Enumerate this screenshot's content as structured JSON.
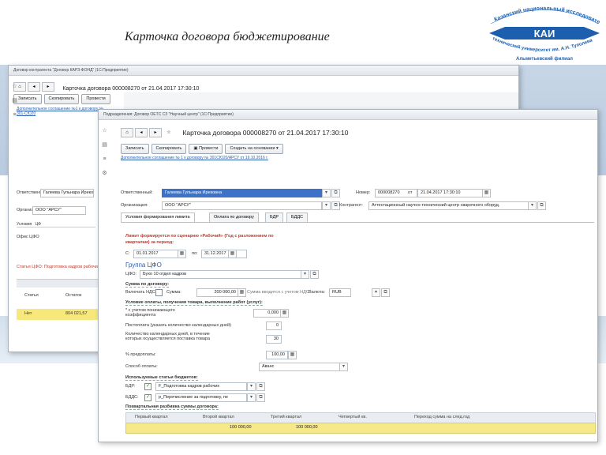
{
  "slide": {
    "title": "Карточка договора бюджетирование",
    "logo_text_top": "Казанский национальный исследовательский",
    "logo_text_mid": "технический университет им. А.Н. Туполева",
    "logo_text_bottom": "Альметьевский филиал",
    "logo_mark": "КАИ",
    "brand_color": "#1b5fae"
  },
  "back_window": {
    "titlebar": "Договор контрагента \"Договор КАРЗ-ФОНД\" (1С:Предприятие)",
    "title": "Карточка договора 000008270 от 21.04.2017 17:30:10",
    "buttons": [
      "Записать",
      "Скопировать",
      "Провести"
    ],
    "link": "Дополнительное соглашение №1 к договору № 301-СЮ20",
    "responsible_label": "Ответственный",
    "responsible_value": "Галеева Гульнара Ирековна",
    "org_label": "Организация",
    "org_value": "ООО \"АРСУ\"",
    "tab_label": "Условия",
    "tab_label2": "ЦФ",
    "group_label": "Офис ЦФО",
    "rows": [
      {
        "a": "Статья",
        "b": "Остаток"
      },
      {
        "a": "Нет",
        "b": "804 021,57"
      },
      {
        "a": "Нет",
        "b": "804 021,57"
      }
    ],
    "note": "Статья ЦФО: Подготовка кадров рабочих"
  },
  "front_window": {
    "titlebar": "Подразделения: Договор ОЕТС СЗ \"Научный центр\" (1С:Предприятие)",
    "title": "Карточка договора 000008270 от 21.04.2017 17:30:10",
    "nav_icons": [
      "home-icon",
      "back-icon",
      "forward-icon",
      "star-icon"
    ],
    "buttons": [
      "Записать",
      "Скопировать",
      "Провести",
      "Создать на основании"
    ],
    "link": "Дополнительное соглашение № 1 к договору № 301СЮ20/АРСУ от 19.10.2016 г.",
    "responsible_label": "Ответственный:",
    "responsible_value": "Галеева Гульнара Ирековна",
    "number_label": "Номер:",
    "number_value": "000008270",
    "date_label": "от",
    "date_value": "21.04.2017 17:30:10",
    "org_label": "Организация:",
    "org_value": "ООО \"АРСУ\"",
    "counterparty_label": "Контрагент:",
    "counterparty_value": "Аттестационный научно-технический центр сварочного оборуд.",
    "tabs": [
      "Условия формирования лимита",
      "Оплата по договору",
      "БДР",
      "БДДС"
    ],
    "limit_note_line1": "Лимит формируется по сценарию «Рабочий» (Год с разложением по",
    "limit_note_line2": "кварталам) за период:",
    "period_from_label": "С:",
    "period_from": "01.01.2017",
    "period_to_label": "по:",
    "period_to": "31.12.2017",
    "group_title": "Группа ЦФО",
    "cfo_label": "ЦФО:",
    "cfo_value": "Бухо 10 отдел кадров",
    "sum_section": "Сумма по договору:",
    "vat_label": "Включать НДС",
    "sum_label": "Сумма:",
    "sum_value": "200 000,00",
    "sum_vat_note": "Сумма вводится с учетом НДС",
    "currency_label": "Валюта:",
    "currency_value": "RUB",
    "payment_section": "Условие оплаты, получения товара, выполнение работ (услуг):",
    "advance_coef_label": "* с учетом понижающего коэффициента",
    "advance_coef_value": "0,000",
    "postpay_label": "Постоплата (указать количество календарных дней)",
    "postpay_value": "0",
    "days_label": "Количество календарных дней, в течение которых осуществляется поставка товара",
    "days_value": "30",
    "prepay_label": "% предоплаты:",
    "prepay_value": "100,00",
    "pay_method_label": "Способ оплаты:",
    "pay_method_value": "Аванс",
    "items_section": "Используемые статьи бюджетов:",
    "bdr_label": "БДР:",
    "bdr_value": "F_Подготовка кадров рабочих",
    "bdds_label": "БДДС:",
    "bdds_value": "р_Перечисление за подготовку, пе",
    "quarter_section": "Поквартальная разбивка суммы договора:",
    "table_headers": [
      "Первый квартал",
      "Второй квартал",
      "Третий квартал",
      "Четвертый кв.",
      "Переход сумма на след.год"
    ],
    "table_row": [
      "",
      "100 000,00",
      "",
      "100 000,00",
      "",
      ""
    ]
  }
}
